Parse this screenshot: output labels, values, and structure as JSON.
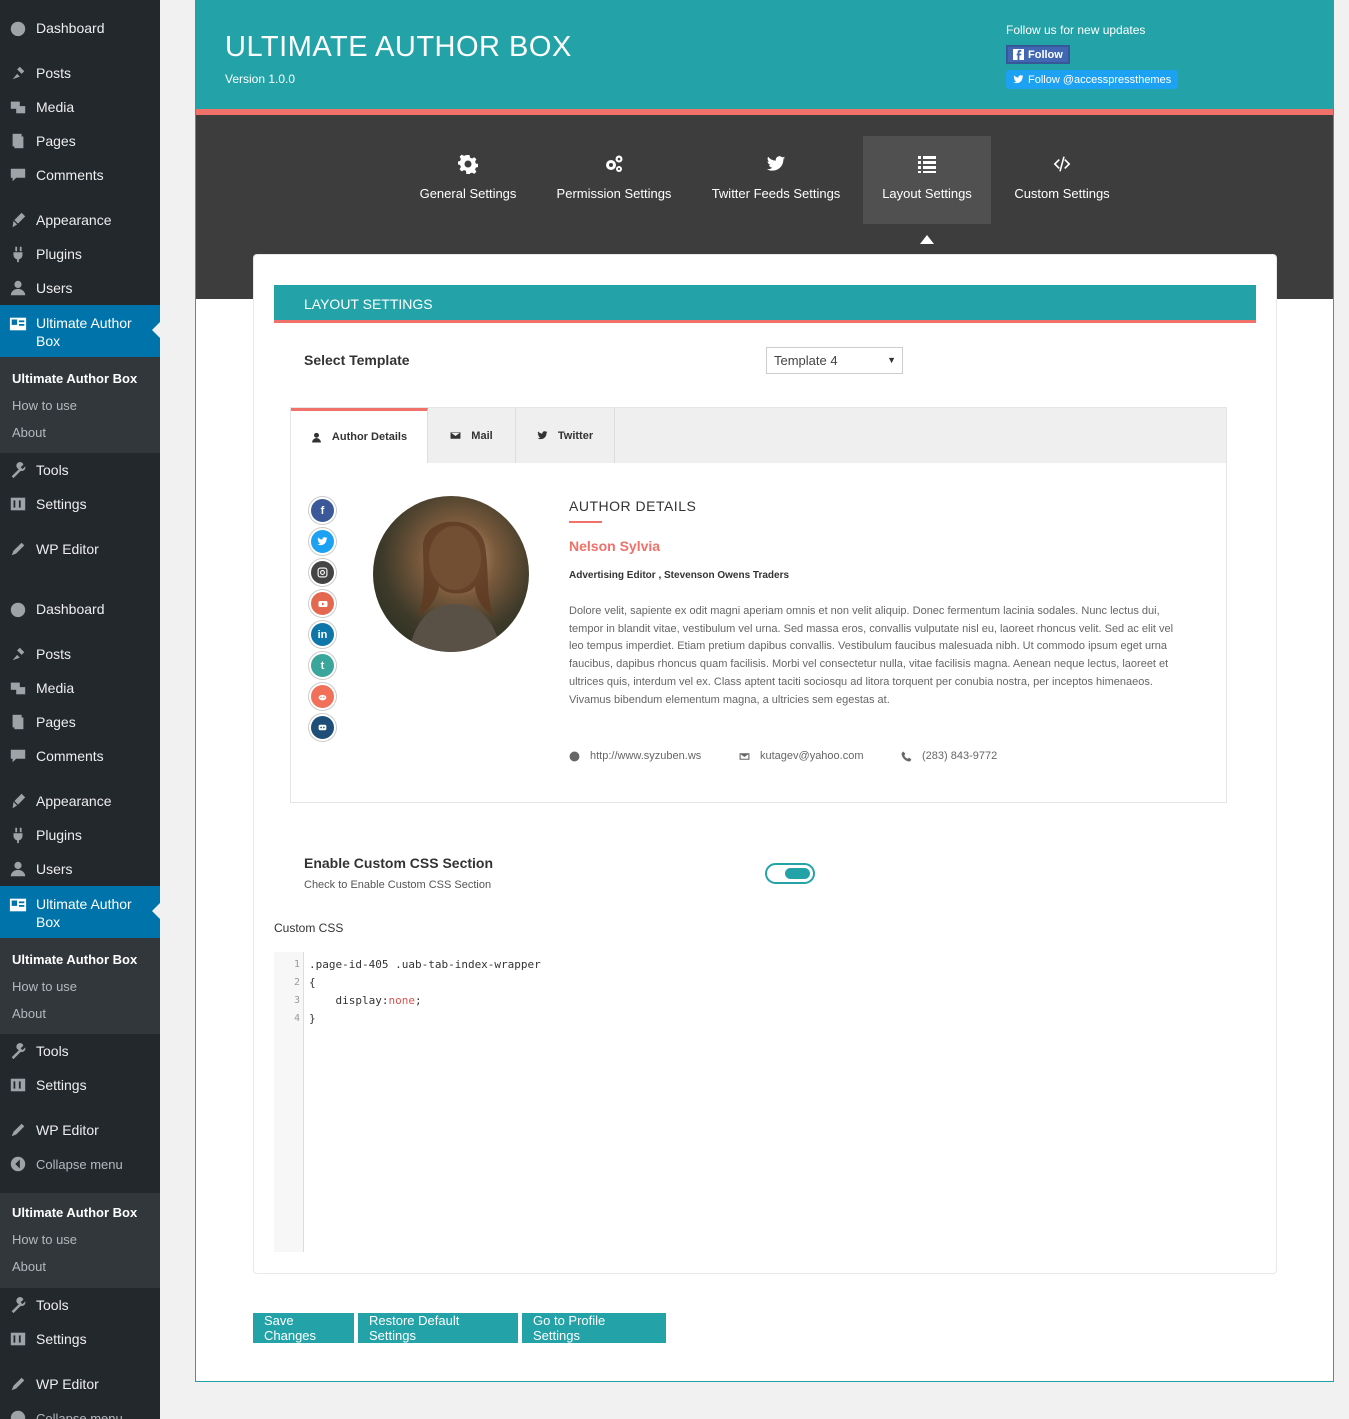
{
  "sidebar": {
    "group1": {
      "dashboard": "Dashboard",
      "posts": "Posts",
      "media": "Media",
      "pages": "Pages",
      "comments": "Comments",
      "appearance": "Appearance",
      "plugins": "Plugins",
      "users": "Users",
      "active": "Ultimate Author Box",
      "sub": [
        "Ultimate Author Box",
        "How to use",
        "About"
      ],
      "tools": "Tools",
      "settings": "Settings",
      "wp_editor": "WP Editor"
    },
    "group2": {
      "dashboard": "Dashboard",
      "posts": "Posts",
      "media": "Media",
      "pages": "Pages",
      "comments": "Comments",
      "appearance": "Appearance",
      "plugins": "Plugins",
      "users": "Users",
      "active": "Ultimate Author Box",
      "sub": [
        "Ultimate Author Box",
        "How to use",
        "About"
      ],
      "tools": "Tools",
      "settings": "Settings",
      "wp_editor": "WP Editor",
      "collapse": "Collapse menu"
    },
    "group3": {
      "sub": [
        "Ultimate Author Box",
        "How to use",
        "About"
      ],
      "tools": "Tools",
      "settings": "Settings",
      "wp_editor": "WP Editor",
      "collapse": "Collapse menu"
    }
  },
  "header": {
    "title": "ULTIMATE AUTHOR BOX",
    "version": "Version 1.0.0",
    "follow_text": "Follow us for new updates",
    "fb_follow": "Follow",
    "tw_follow": "Follow @accesspressthemes"
  },
  "nav": {
    "tabs": [
      "General Settings",
      "Permission Settings",
      "Twitter Feeds Settings",
      "Layout Settings",
      "Custom Settings"
    ],
    "active_index": 3
  },
  "layout": {
    "section_title": "LAYOUT SETTINGS",
    "select_template_label": "Select Template",
    "template_value": "Template 4",
    "preview": {
      "tabs": [
        "Author Details",
        "Mail",
        "Twitter"
      ],
      "social": [
        "facebook-icon",
        "twitter-icon",
        "instagram-icon",
        "youtube-icon",
        "linkedin-icon",
        "tumblr-icon",
        "reddit-icon",
        "flickr-icon"
      ],
      "heading": "AUTHOR DETAILS",
      "name": "Nelson Sylvia",
      "role": "Advertising Editor , Stevenson Owens Traders",
      "bio": "Dolore velit, sapiente ex odit magni aperiam omnis et non velit aliquip. Donec fermentum lacinia sodales. Nunc lectus dui, tempor in blandit vitae, vestibulum vel urna. Sed massa eros, convallis vulputate nisl eu, laoreet rhoncus velit. Sed ac elit vel leo tempus imperdiet. Etiam pretium dapibus convallis. Vestibulum faucibus malesuada nibh. Ut commodo ipsum eget urna faucibus, dapibus rhoncus quam facilisis. Morbi vel consectetur nulla, vitae facilisis magna. Aenean neque lectus, laoreet et ultrices quis, interdum vel ex. Class aptent taciti sociosqu ad litora torquent per conubia nostra, per inceptos himenaeos. Vivamus bibendum elementum magna, a ultricies sem egestas at.",
      "website": "http://www.syzuben.ws",
      "email": "kutagev@yahoo.com",
      "phone": "(283) 843-9772"
    },
    "custom_css_label": "Enable Custom CSS Section",
    "custom_css_desc": "Check to Enable Custom CSS Section",
    "custom_css_enabled": true,
    "custom_css_field_label": "Custom CSS",
    "code_lines": [
      ".page-id-405 .uab-tab-index-wrapper",
      "{",
      "    display:",
      "}"
    ],
    "code_keyword": "none",
    "line_numbers": [
      "1",
      "2",
      "3",
      "4"
    ]
  },
  "buttons": {
    "save": "Save Changes",
    "restore": "Restore Default Settings",
    "profile": "Go to Profile Settings"
  },
  "colors": {
    "teal": "#23a3a8",
    "coral": "#f0706a",
    "wp_blue": "#0073aa",
    "sidebar": "#23282d"
  }
}
